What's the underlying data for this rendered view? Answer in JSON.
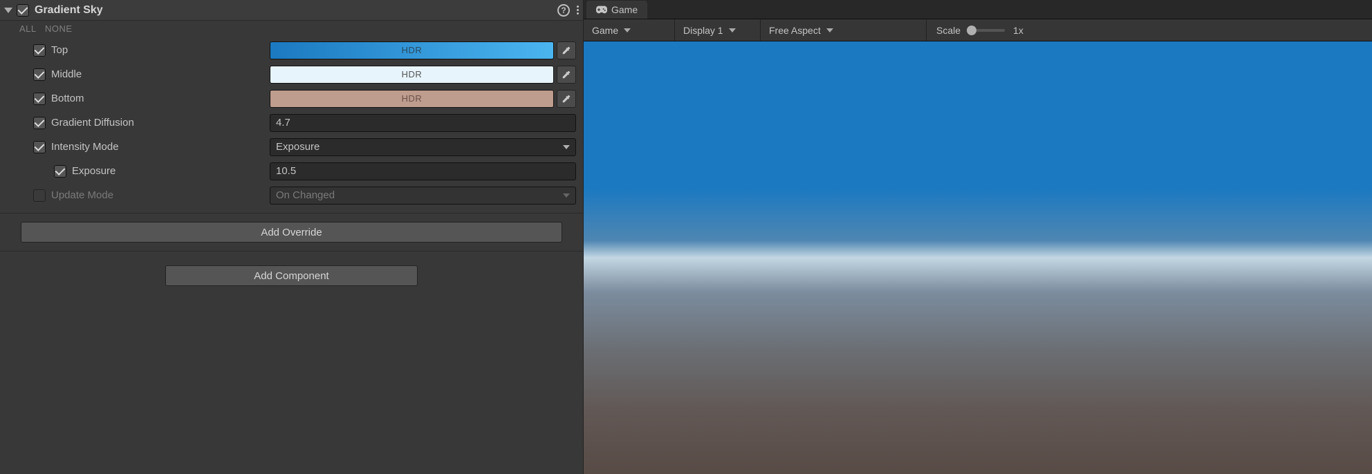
{
  "inspector": {
    "component_title": "Gradient Sky",
    "all_label": "ALL",
    "none_label": "NONE",
    "hdr_label": "HDR",
    "props": {
      "top": {
        "label": "Top",
        "color_start": "#1b79c1",
        "color_end": "#4bb5f0"
      },
      "middle": {
        "label": "Middle",
        "color": "#e7f4fb"
      },
      "bottom": {
        "label": "Bottom",
        "color": "#be9c8e"
      },
      "gradient_diffusion": {
        "label": "Gradient Diffusion",
        "value": "4.7"
      },
      "intensity_mode": {
        "label": "Intensity Mode",
        "value": "Exposure"
      },
      "exposure": {
        "label": "Exposure",
        "value": "10.5"
      },
      "update_mode": {
        "label": "Update Mode",
        "value": "On Changed"
      }
    },
    "add_override": "Add Override",
    "add_component": "Add Component"
  },
  "game": {
    "tab_label": "Game",
    "view_dropdown": "Game",
    "display_dropdown": "Display 1",
    "aspect_dropdown": "Free Aspect",
    "scale_label": "Scale",
    "scale_value": "1x"
  }
}
